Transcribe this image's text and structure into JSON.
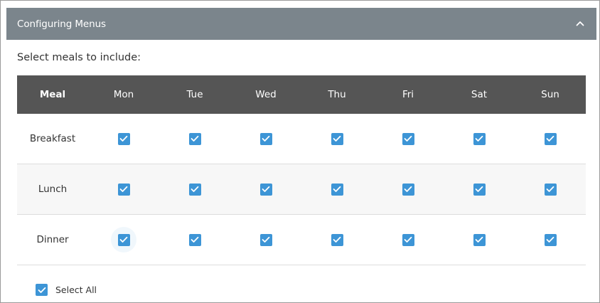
{
  "panel": {
    "title": "Configuring Menus"
  },
  "instruction": "Select meals to include:",
  "grid": {
    "columns": [
      "Meal",
      "Mon",
      "Tue",
      "Wed",
      "Thu",
      "Fri",
      "Sat",
      "Sun"
    ],
    "rows": [
      {
        "meal": "Breakfast",
        "checked": [
          true,
          true,
          true,
          true,
          true,
          true,
          true
        ]
      },
      {
        "meal": "Lunch",
        "checked": [
          true,
          true,
          true,
          true,
          true,
          true,
          true
        ]
      },
      {
        "meal": "Dinner",
        "checked": [
          true,
          true,
          true,
          true,
          true,
          true,
          true
        ]
      }
    ]
  },
  "select_all": {
    "label": "Select All",
    "checked": true
  },
  "colors": {
    "header_bg": "#7b858c",
    "table_header_bg": "#555555",
    "checkbox": "#3d95d6",
    "alt_row": "#f7f7f7"
  },
  "icons": {
    "collapse": "chevron-up-icon",
    "checkbox": "checkmark-icon"
  }
}
